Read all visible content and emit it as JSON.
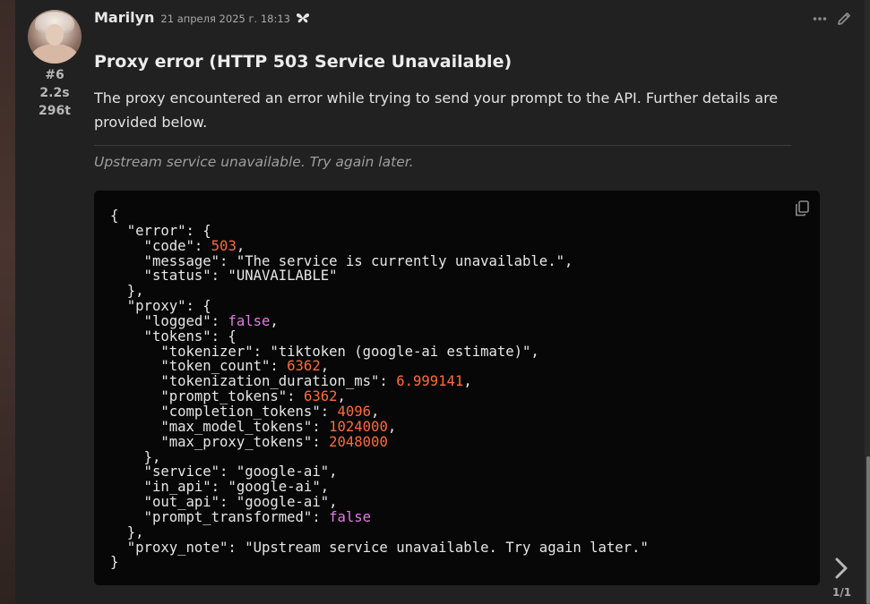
{
  "post": {
    "author": "Marilyn",
    "date": "21 апреля 2025 г. 18:13",
    "number": "#6",
    "time": "2.2s",
    "tokens": "296t",
    "title": "Proxy error (HTTP 503 Service Unavailable)",
    "text": "The proxy encountered an error while trying to send your prompt to the API. Further details are provided below.",
    "note": "Upstream service unavailable. Try again later."
  },
  "code": {
    "lines": [
      [
        {
          "t": "{",
          "c": "p"
        }
      ],
      [
        {
          "t": "  \"error\": {",
          "c": "p"
        }
      ],
      [
        {
          "t": "    \"code\": ",
          "c": "p"
        },
        {
          "t": "503",
          "c": "num"
        },
        {
          "t": ",",
          "c": "p"
        }
      ],
      [
        {
          "t": "    \"message\": \"The service is currently unavailable.\",",
          "c": "p"
        }
      ],
      [
        {
          "t": "    \"status\": \"UNAVAILABLE\"",
          "c": "p"
        }
      ],
      [
        {
          "t": "  },",
          "c": "p"
        }
      ],
      [
        {
          "t": "  \"proxy\": {",
          "c": "p"
        }
      ],
      [
        {
          "t": "    \"logged\": ",
          "c": "p"
        },
        {
          "t": "false",
          "c": "bool"
        },
        {
          "t": ",",
          "c": "p"
        }
      ],
      [
        {
          "t": "    \"tokens\": {",
          "c": "p"
        }
      ],
      [
        {
          "t": "      \"tokenizer\": \"tiktoken (google-ai estimate)\",",
          "c": "p"
        }
      ],
      [
        {
          "t": "      \"token_count\": ",
          "c": "p"
        },
        {
          "t": "6362",
          "c": "num"
        },
        {
          "t": ",",
          "c": "p"
        }
      ],
      [
        {
          "t": "      \"tokenization_duration_ms\": ",
          "c": "p"
        },
        {
          "t": "6.999141",
          "c": "num"
        },
        {
          "t": ",",
          "c": "p"
        }
      ],
      [
        {
          "t": "      \"prompt_tokens\": ",
          "c": "p"
        },
        {
          "t": "6362",
          "c": "num"
        },
        {
          "t": ",",
          "c": "p"
        }
      ],
      [
        {
          "t": "      \"completion_tokens\": ",
          "c": "p"
        },
        {
          "t": "4096",
          "c": "num"
        },
        {
          "t": ",",
          "c": "p"
        }
      ],
      [
        {
          "t": "      \"max_model_tokens\": ",
          "c": "p"
        },
        {
          "t": "1024000",
          "c": "num"
        },
        {
          "t": ",",
          "c": "p"
        }
      ],
      [
        {
          "t": "      \"max_proxy_tokens\": ",
          "c": "p"
        },
        {
          "t": "2048000",
          "c": "num"
        }
      ],
      [
        {
          "t": "    },",
          "c": "p"
        }
      ],
      [
        {
          "t": "    \"service\": \"google-ai\",",
          "c": "p"
        }
      ],
      [
        {
          "t": "    \"in_api\": \"google-ai\",",
          "c": "p"
        }
      ],
      [
        {
          "t": "    \"out_api\": \"google-ai\",",
          "c": "p"
        }
      ],
      [
        {
          "t": "    \"prompt_transformed\": ",
          "c": "p"
        },
        {
          "t": "false",
          "c": "bool"
        }
      ],
      [
        {
          "t": "  },",
          "c": "p"
        }
      ],
      [
        {
          "t": "  \"proxy_note\": \"Upstream service unavailable. Try again later.\"",
          "c": "p"
        }
      ],
      [
        {
          "t": "}",
          "c": "p"
        }
      ]
    ]
  },
  "pager": {
    "count": "1/1"
  },
  "icons": {
    "more": "more-horizontal-icon",
    "edit": "pencil-icon",
    "copy": "copy-icon",
    "next": "chevron-right-icon",
    "badge": "butterfly-icon"
  },
  "colors": {
    "number": "#ff6a3d",
    "boolean": "#e07be0",
    "code_bg": "#070707",
    "post_bg": "#212121"
  }
}
